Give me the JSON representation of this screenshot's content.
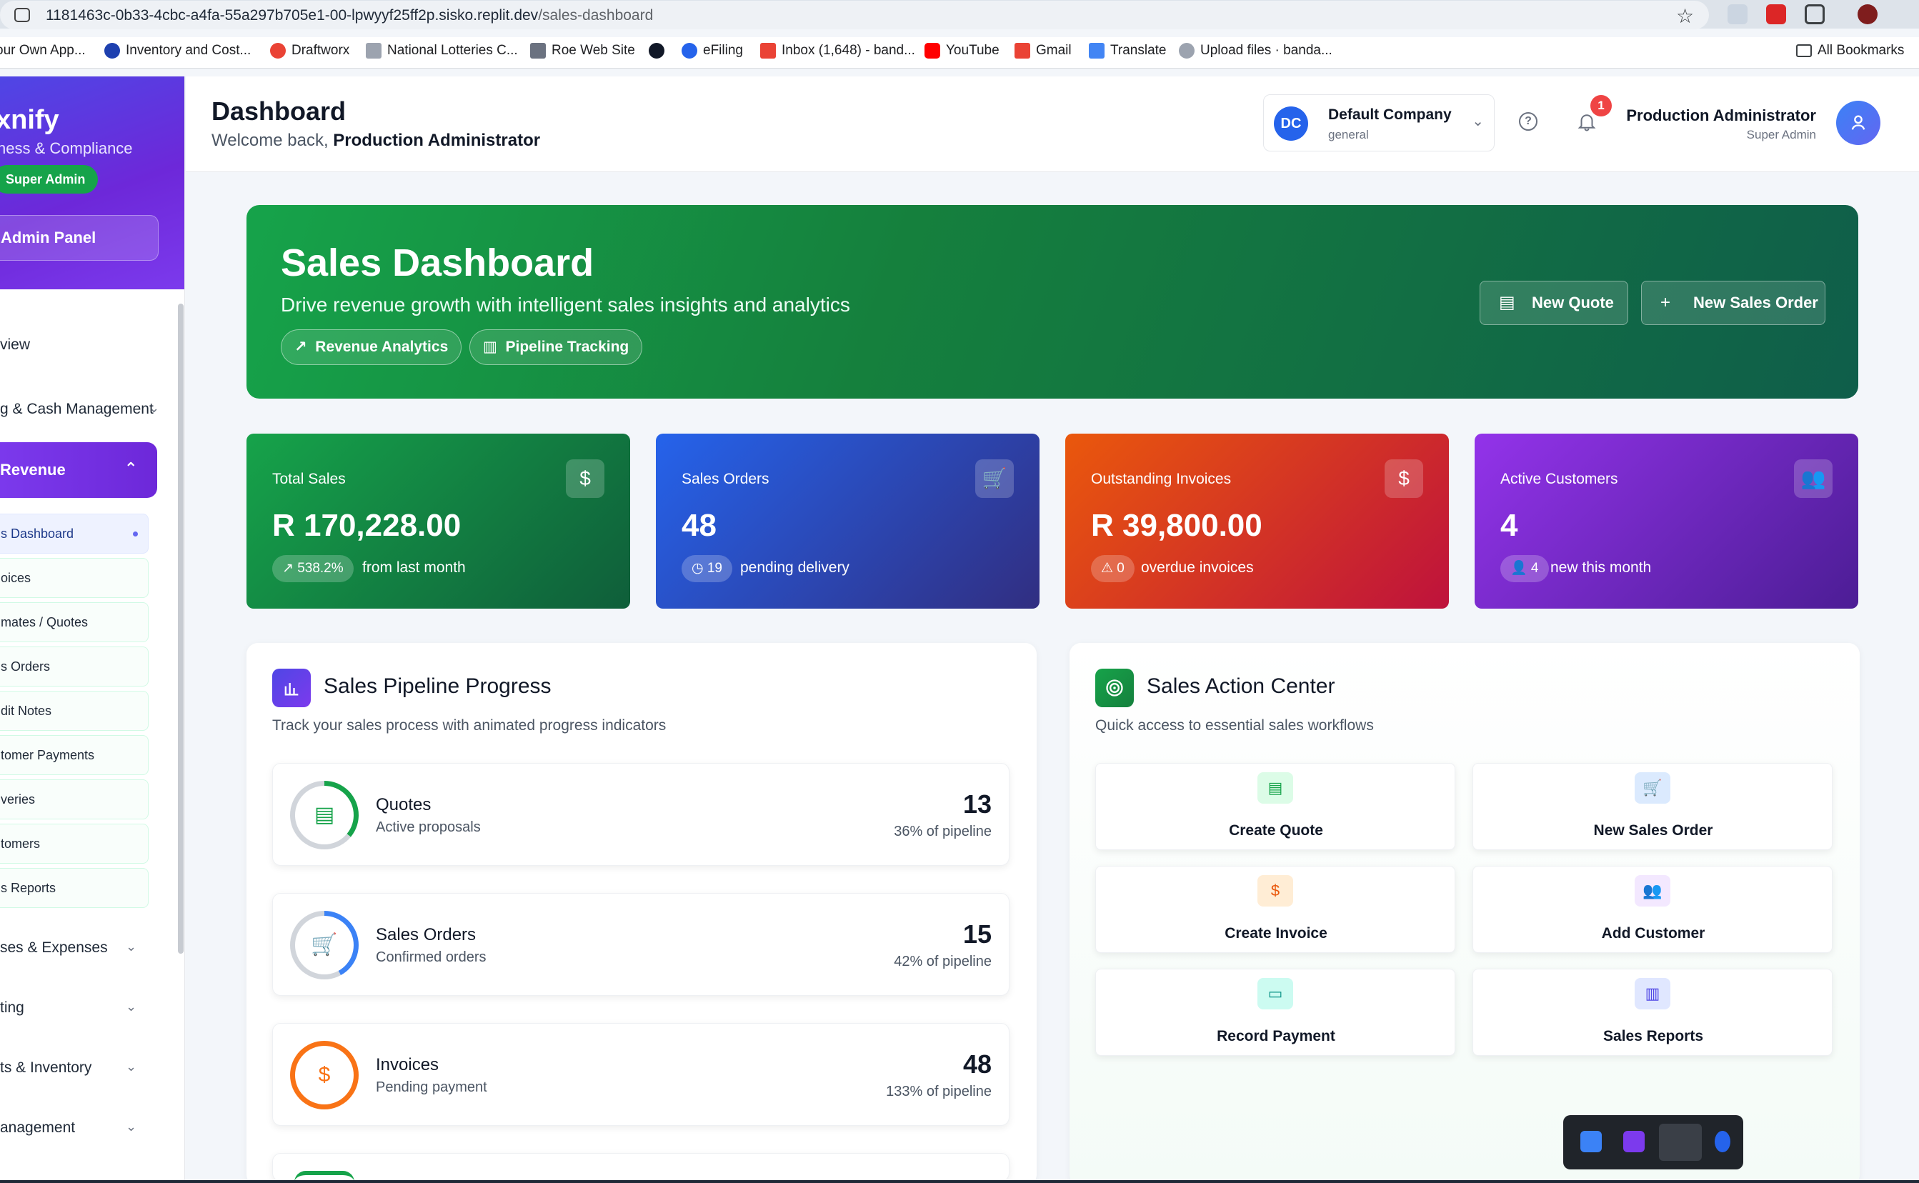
{
  "browser": {
    "url_host": "1181463c-0b33-4cbc-a4fa-55a297b705e1-00-lpwyyf25ff2p.sisko.replit.dev",
    "url_path": "/sales-dashboard",
    "bookmarks": [
      {
        "label": "our Own App...",
        "color": "#e5e7eb"
      },
      {
        "label": "Inventory and Cost...",
        "color": "#1e40af"
      },
      {
        "label": "Draftworx",
        "color": "#ea4335"
      },
      {
        "label": "National Lotteries C...",
        "color": "#9ca3af"
      },
      {
        "label": "Roe Web Site",
        "color": "#6b7280"
      },
      {
        "label": "",
        "color": "#111827"
      },
      {
        "label": "eFiling",
        "color": "#2563eb"
      },
      {
        "label": "Inbox (1,648) - band...",
        "color": "#ea4335"
      },
      {
        "label": "YouTube",
        "color": "#ff0000"
      },
      {
        "label": "Gmail",
        "color": "#ea4335"
      },
      {
        "label": "Translate",
        "color": "#4285f4"
      },
      {
        "label": "Upload files · banda...",
        "color": "#9ca3af"
      }
    ],
    "all_bookmarks": "All Bookmarks"
  },
  "sidebar": {
    "brand_name": "xnify",
    "brand_sub": "ness & Compliance",
    "role_badge": "Super Admin",
    "admin_panel": "Admin Panel",
    "overview": "view",
    "banking": "g & Cash Management",
    "revenue": "Revenue",
    "sub_items": [
      "s Dashboard",
      "oices",
      "mates / Quotes",
      "s Orders",
      "dit Notes",
      "tomer Payments",
      "veries",
      "tomers",
      "s Reports"
    ],
    "groups": [
      "ses & Expenses",
      "ting",
      "ts & Inventory",
      "anagement"
    ]
  },
  "header": {
    "title": "Dashboard",
    "welcome_prefix": "Welcome back, ",
    "welcome_name": "Production Administrator",
    "company_initials": "DC",
    "company_name": "Default Company",
    "company_type": "general",
    "notification_count": "1",
    "user_name": "Production Administrator",
    "user_role": "Super Admin"
  },
  "hero": {
    "title": "Sales Dashboard",
    "subtitle": "Drive revenue growth with intelligent sales insights and analytics",
    "pill_revenue": "Revenue Analytics",
    "pill_pipeline": "Pipeline Tracking",
    "btn_new_quote": "New Quote",
    "btn_new_sales_order": "New Sales Order"
  },
  "stats": [
    {
      "label": "Total Sales",
      "value": "R 170,228.00",
      "chip": "↗ 538.2%",
      "note": "from last month",
      "icon": "$"
    },
    {
      "label": "Sales Orders",
      "value": "48",
      "chip": "◷ 19",
      "note": "pending delivery",
      "icon": "🛒"
    },
    {
      "label": "Outstanding Invoices",
      "value": "R 39,800.00",
      "chip": "⚠ 0",
      "note": "overdue invoices",
      "icon": "$"
    },
    {
      "label": "Active Customers",
      "value": "4",
      "chip": "👤 4",
      "note": "new this month",
      "icon": "👥"
    }
  ],
  "pipeline": {
    "title": "Sales Pipeline Progress",
    "subtitle": "Track your sales process with animated progress indicators",
    "items": [
      {
        "name": "Quotes",
        "desc": "Active proposals",
        "count": "13",
        "pct": "36% of pipeline",
        "progress": 0.36,
        "color": "#16a34a"
      },
      {
        "name": "Sales Orders",
        "desc": "Confirmed orders",
        "count": "15",
        "pct": "42% of pipeline",
        "progress": 0.42,
        "color": "#3b82f6"
      },
      {
        "name": "Invoices",
        "desc": "Pending payment",
        "count": "48",
        "pct": "133% of pipeline",
        "progress": 1.0,
        "color": "#f97316"
      }
    ]
  },
  "actions": {
    "title": "Sales Action Center",
    "subtitle": "Quick access to essential sales workflows",
    "items": [
      {
        "label": "Create Quote",
        "icon": "doc-icon",
        "bg": "#dcfce7",
        "fg": "#16a34a"
      },
      {
        "label": "New Sales Order",
        "icon": "cart-icon",
        "bg": "#dbeafe",
        "fg": "#2563eb"
      },
      {
        "label": "Create Invoice",
        "icon": "invoice-icon",
        "bg": "#ffedd5",
        "fg": "#ea580c"
      },
      {
        "label": "Add Customer",
        "icon": "users-icon",
        "bg": "#f3e8ff",
        "fg": "#9333ea"
      },
      {
        "label": "Record Payment",
        "icon": "card-icon",
        "bg": "#ccfbf1",
        "fg": "#0d9488"
      },
      {
        "label": "Sales Reports",
        "icon": "bar-chart-icon",
        "bg": "#e0e7ff",
        "fg": "#4f46e5"
      }
    ]
  }
}
